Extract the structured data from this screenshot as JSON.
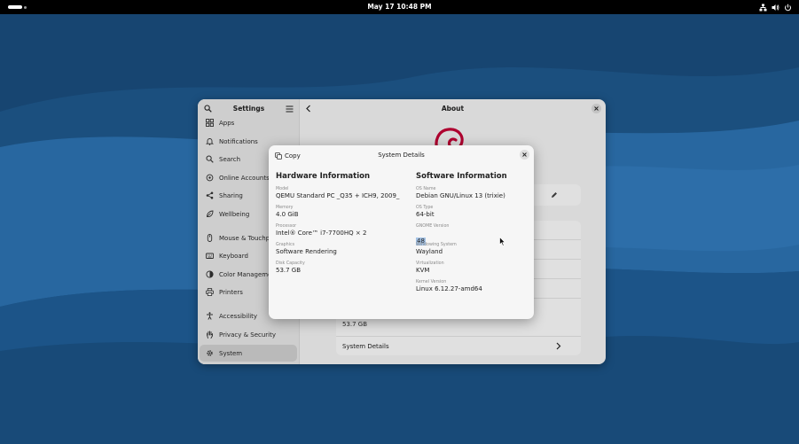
{
  "topbar": {
    "clock": "May 17  10:48 PM",
    "tray_icons": [
      "network-icon",
      "volume-icon",
      "power-icon"
    ]
  },
  "settings": {
    "sidebar_title": "Settings",
    "sidebar_items": [
      {
        "label": "Apps",
        "icon": "apps-icon"
      },
      {
        "label": "Notifications",
        "icon": "bell-icon"
      },
      {
        "label": "Search",
        "icon": "search-icon"
      },
      {
        "label": "Online Accounts",
        "icon": "cloud-icon"
      },
      {
        "label": "Sharing",
        "icon": "share-icon"
      },
      {
        "label": "Wellbeing",
        "icon": "wellbeing-icon"
      },
      {
        "label": "Mouse & Touchpad",
        "icon": "mouse-icon"
      },
      {
        "label": "Keyboard",
        "icon": "keyboard-icon"
      },
      {
        "label": "Color Management",
        "icon": "color-icon"
      },
      {
        "label": "Printers",
        "icon": "printer-icon"
      },
      {
        "label": "Accessibility",
        "icon": "accessibility-icon"
      },
      {
        "label": "Privacy & Security",
        "icon": "hand-icon"
      },
      {
        "label": "System",
        "icon": "gear-icon"
      }
    ],
    "active_item": "System",
    "page_title": "About",
    "disk_capacity_value": "53.7 GB",
    "system_details_label": "System Details"
  },
  "dialog": {
    "copy_label": "Copy",
    "title": "System Details",
    "hardware": {
      "heading": "Hardware Information",
      "fields": [
        {
          "label": "Model",
          "value": "QEMU Standard PC _Q35 + ICH9, 2009_"
        },
        {
          "label": "Memory",
          "value": "4.0 GiB"
        },
        {
          "label": "Processor",
          "value": "Intel® Core™ i7-7700HQ × 2"
        },
        {
          "label": "Graphics",
          "value": "Software Rendering"
        },
        {
          "label": "Disk Capacity",
          "value": "53.7 GB"
        }
      ]
    },
    "software": {
      "heading": "Software Information",
      "fields": [
        {
          "label": "OS Name",
          "value": "Debian GNU/Linux 13 (trixie)"
        },
        {
          "label": "OS Type",
          "value": "64-bit"
        },
        {
          "label": "GNOME Version",
          "value": "48"
        },
        {
          "label": "Windowing System",
          "value": "Wayland"
        },
        {
          "label": "Virtualization",
          "value": "KVM"
        },
        {
          "label": "Kernel Version",
          "value": "Linux 6.12.27-amd64"
        }
      ]
    }
  },
  "colors": {
    "wallpaper_dark": "#17466f",
    "wallpaper_light": "#2b6da6",
    "selection": "#a4c3e6",
    "debian_red": "#c70036"
  }
}
